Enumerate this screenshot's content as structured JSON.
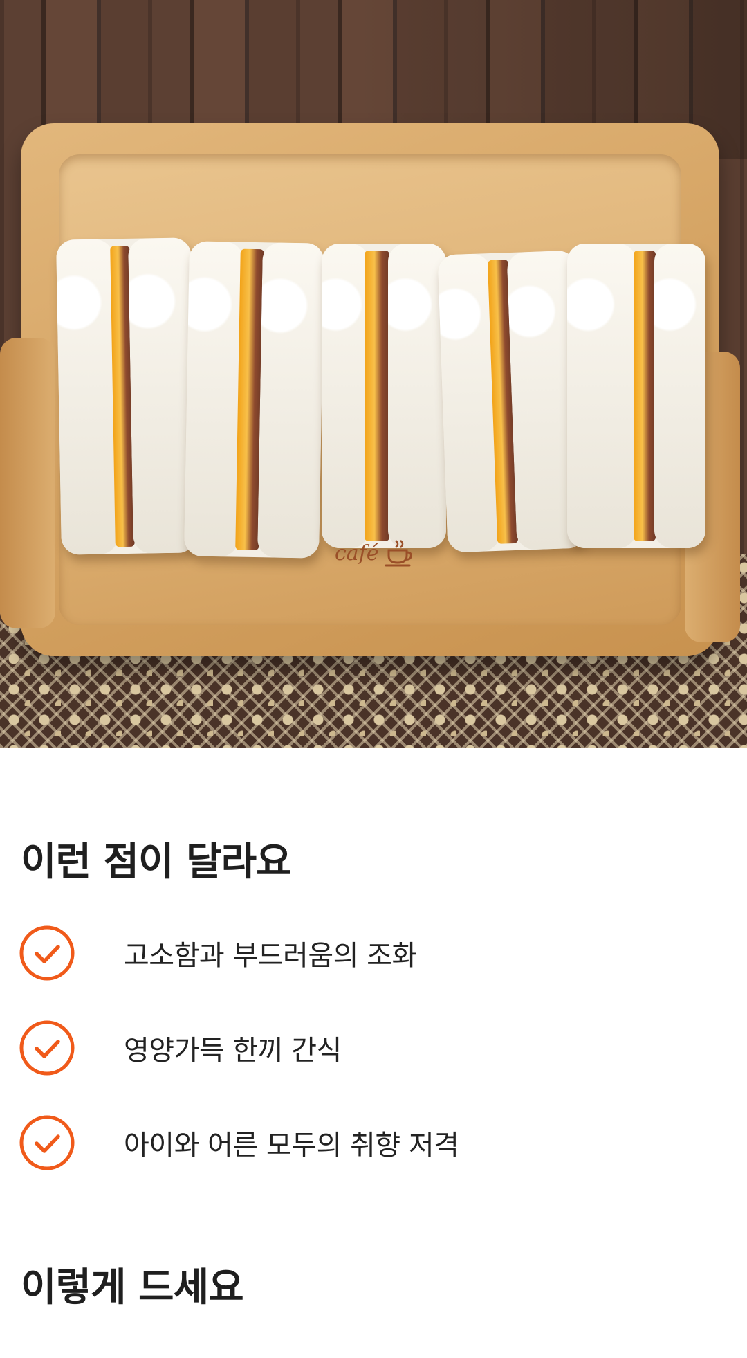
{
  "hero": {
    "brand_mark": "café",
    "brand_mark_icon": "coffee-cup-icon"
  },
  "colors": {
    "accent": "#f05a1a",
    "text": "#1f1f1f",
    "background": "#ffffff"
  },
  "sections": {
    "differences": {
      "title": "이런 점이 달라요",
      "items": [
        {
          "icon": "check-circle-icon",
          "label": "고소함과 부드러움의 조화"
        },
        {
          "icon": "check-circle-icon",
          "label": "영양가득 한끼 간식"
        },
        {
          "icon": "check-circle-icon",
          "label": "아이와 어른 모두의 취향 저격"
        }
      ]
    },
    "how_to_eat": {
      "title": "이렇게 드세요"
    }
  }
}
